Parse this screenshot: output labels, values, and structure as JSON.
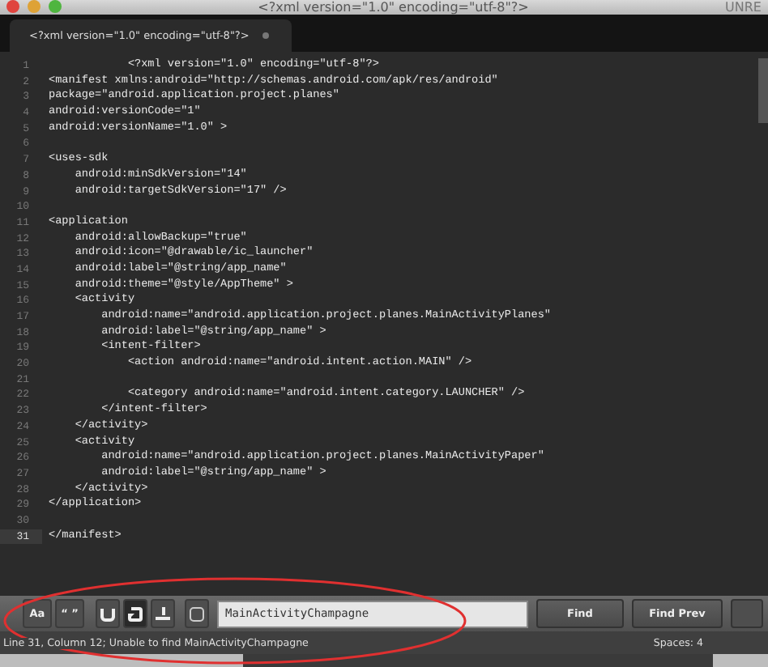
{
  "window": {
    "title": "<?xml version=\"1.0\" encoding=\"utf-8\"?>",
    "title_right": "UNRE"
  },
  "tabs": [
    {
      "label": "<?xml version=\"1.0\" encoding=\"utf-8\"?>",
      "selected": true,
      "modified": true
    }
  ],
  "editor": {
    "lines": [
      {
        "number": "1",
        "text": "            <?xml version=\"1.0\" encoding=\"utf-8\"?>",
        "current": false
      },
      {
        "number": "2",
        "text": "<manifest xmlns:android=\"http://schemas.android.com/apk/res/android\"",
        "current": false
      },
      {
        "number": "3",
        "text": "package=\"android.application.project.planes\"",
        "current": false
      },
      {
        "number": "4",
        "text": "android:versionCode=\"1\"",
        "current": false
      },
      {
        "number": "5",
        "text": "android:versionName=\"1.0\" >",
        "current": false
      },
      {
        "number": "6",
        "current": false
      },
      {
        "number": "7",
        "text": "<uses-sdk",
        "current": false
      },
      {
        "number": "8",
        "text": "    android:minSdkVersion=\"14\"",
        "current": false
      },
      {
        "number": "9",
        "text": "    android:targetSdkVersion=\"17\" />",
        "current": false
      },
      {
        "number": "10",
        "current": false
      },
      {
        "number": "11",
        "text": "<application",
        "current": false
      },
      {
        "number": "12",
        "text": "    android:allowBackup=\"true\"",
        "current": false
      },
      {
        "number": "13",
        "text": "    android:icon=\"@drawable/ic_launcher\"",
        "current": false
      },
      {
        "number": "14",
        "text": "    android:label=\"@string/app_name\"",
        "current": false
      },
      {
        "number": "15",
        "text": "    android:theme=\"@style/AppTheme\" >",
        "current": false
      },
      {
        "number": "16",
        "text": "    <activity",
        "current": false
      },
      {
        "number": "17",
        "text": "        android:name=\"android.application.project.planes.MainActivityPlanes\"",
        "current": false
      },
      {
        "number": "18",
        "text": "        android:label=\"@string/app_name\" >",
        "current": false
      },
      {
        "number": "19",
        "text": "        <intent-filter>",
        "current": false
      },
      {
        "number": "20",
        "text": "            <action android:name=\"android.intent.action.MAIN\" />",
        "current": false
      },
      {
        "number": "21",
        "current": false
      },
      {
        "number": "22",
        "text": "            <category android:name=\"android.intent.category.LAUNCHER\" />",
        "current": false
      },
      {
        "number": "23",
        "text": "        </intent-filter>",
        "current": false
      },
      {
        "number": "24",
        "text": "    </activity>",
        "current": false
      },
      {
        "number": "25",
        "text": "    <activity",
        "current": false
      },
      {
        "number": "26",
        "text": "        android:name=\"android.application.project.planes.MainActivityPaper\"",
        "current": false
      },
      {
        "number": "27",
        "text": "        android:label=\"@string/app_name\" >",
        "current": false
      },
      {
        "number": "28",
        "text": "    </activity>",
        "current": false
      },
      {
        "number": "29",
        "text": "</application>",
        "current": false
      },
      {
        "number": "30",
        "current": false
      },
      {
        "number": "31",
        "text": "</manifest>",
        "current": true
      }
    ]
  },
  "find_bar": {
    "options": [
      {
        "kind": "text",
        "label": "Aa",
        "selected": false
      },
      {
        "kind": "text",
        "label": "“ ”",
        "selected": false
      },
      {
        "kind": "in-selection",
        "selected": false
      },
      {
        "kind": "wrap",
        "selected": true
      },
      {
        "kind": "highlight",
        "selected": false
      },
      {
        "kind": "context",
        "selected": false
      }
    ],
    "search": {
      "value": "MainActivityChampagne"
    },
    "buttons": [
      "Find",
      "Find Prev"
    ]
  },
  "status_bar": {
    "message": "Line 31, Column 12; Unable to find MainActivityChampagne",
    "indentation": "Spaces: 4"
  }
}
